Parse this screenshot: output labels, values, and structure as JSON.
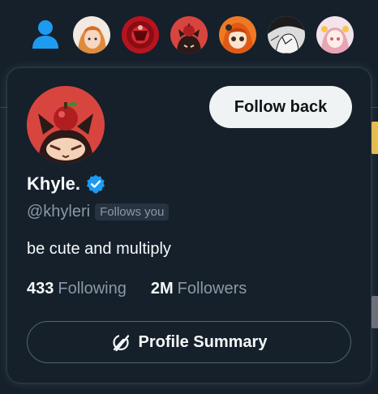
{
  "topbar": {
    "avatars": [
      {
        "icon": "profile-avatar",
        "bg": "#f1e9e2"
      },
      {
        "icon": "profile-avatar",
        "bg": "#b8141e"
      },
      {
        "icon": "profile-avatar",
        "bg": "#d8453f"
      },
      {
        "icon": "profile-avatar",
        "bg": "#f07a24"
      },
      {
        "icon": "profile-avatar",
        "bg": "#dcdcdc"
      },
      {
        "icon": "profile-avatar",
        "bg": "#f3e3ea"
      }
    ]
  },
  "card": {
    "display_name": "Khyle.",
    "handle": "@khyleri",
    "follows_you": "Follows you",
    "bio": "be cute and multiply",
    "following_count": "433",
    "following_label": "Following",
    "followers_count": "2M",
    "followers_label": "Followers",
    "follow_back_label": "Follow back",
    "summary_label": "Profile Summary",
    "verified_color": "#1d9bf0"
  },
  "colors": {
    "background": "#15202b",
    "accent": "#1d9bf0",
    "muted_text": "#8b98a5",
    "button_bg": "#eff3f4"
  }
}
